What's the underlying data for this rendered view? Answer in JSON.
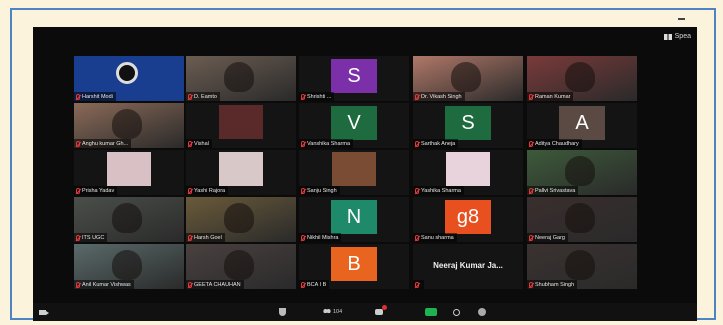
{
  "header": {
    "view_label": "Spea"
  },
  "participants": [
    {
      "name": "Harshit Modi",
      "avatar_letter": "",
      "avatar_color": "#1a3e8f",
      "kind": "logo"
    },
    {
      "name": "D. Eamto",
      "avatar_letter": "",
      "avatar_color": "#6b5d52",
      "kind": "video"
    },
    {
      "name": "Shrishti ...",
      "avatar_letter": "S",
      "avatar_color": "#7b2fa8",
      "kind": "letter"
    },
    {
      "name": "Dr. Vikash Singh",
      "avatar_letter": "",
      "avatar_color": "#b07868",
      "kind": "video"
    },
    {
      "name": "Raman Kumar",
      "avatar_letter": "",
      "avatar_color": "#7a3a3a",
      "kind": "video"
    },
    {
      "name": "Anghu kumar Gh...",
      "avatar_letter": "",
      "avatar_color": "#8a6a58",
      "kind": "video"
    },
    {
      "name": "Vishal",
      "avatar_letter": "",
      "avatar_color": "#5a2a2a",
      "kind": "video"
    },
    {
      "name": "Vanshika Sharma",
      "avatar_letter": "V",
      "avatar_color": "#1e6b3f",
      "kind": "letter"
    },
    {
      "name": "Sarthak Aneja",
      "avatar_letter": "S",
      "avatar_color": "#1e6b3f",
      "kind": "letter"
    },
    {
      "name": "Aditya Chaudhary",
      "avatar_letter": "A",
      "avatar_color": "#5b4a44",
      "kind": "letter"
    },
    {
      "name": "Prisha Yadav",
      "avatar_letter": "",
      "avatar_color": "#d8c0c4",
      "kind": "video"
    },
    {
      "name": "Yashi Rajora",
      "avatar_letter": "",
      "avatar_color": "#d8c8c8",
      "kind": "video"
    },
    {
      "name": "Sanju Singh",
      "avatar_letter": "",
      "avatar_color": "#7a4c34",
      "kind": "video"
    },
    {
      "name": "Yashika Sharma",
      "avatar_letter": "",
      "avatar_color": "#e8d2dc",
      "kind": "video"
    },
    {
      "name": "Pallvi Srivastava",
      "avatar_letter": "",
      "avatar_color": "#3d5a3a",
      "kind": "video"
    },
    {
      "name": "ITS UGC",
      "avatar_letter": "",
      "avatar_color": "#4a4f4a",
      "kind": "video"
    },
    {
      "name": "Harsh Goel",
      "avatar_letter": "",
      "avatar_color": "#6a5a3a",
      "kind": "video"
    },
    {
      "name": "Nikhil Mishra",
      "avatar_letter": "N",
      "avatar_color": "#1f8a6a",
      "kind": "letter"
    },
    {
      "name": "Sanu sharma",
      "avatar_letter": "g8",
      "avatar_color": "#e8501f",
      "kind": "letter"
    },
    {
      "name": "Neeraj Garg",
      "avatar_letter": "",
      "avatar_color": "#3a2e2e",
      "kind": "video"
    },
    {
      "name": "Anil Kumar Vishwas",
      "avatar_letter": "",
      "avatar_color": "#5a6a6a",
      "kind": "video"
    },
    {
      "name": "GEETA CHAUHAN",
      "avatar_letter": "",
      "avatar_color": "#4a4040",
      "kind": "video"
    },
    {
      "name": "BCA I B",
      "avatar_letter": "B",
      "avatar_color": "#e8641f",
      "kind": "letter"
    },
    {
      "name": "Neeraj Kumar Ja...",
      "avatar_letter": "",
      "avatar_color": "#141414",
      "kind": "nameonly"
    },
    {
      "name": "Shubham Singh",
      "avatar_letter": "",
      "avatar_color": "#3a3230",
      "kind": "video"
    }
  ],
  "toolbar": {
    "participants_count": "104"
  },
  "colors": {
    "page_border": "#4f84c4",
    "active_speaker": "#a9c93a",
    "share_green": "#1db351"
  }
}
